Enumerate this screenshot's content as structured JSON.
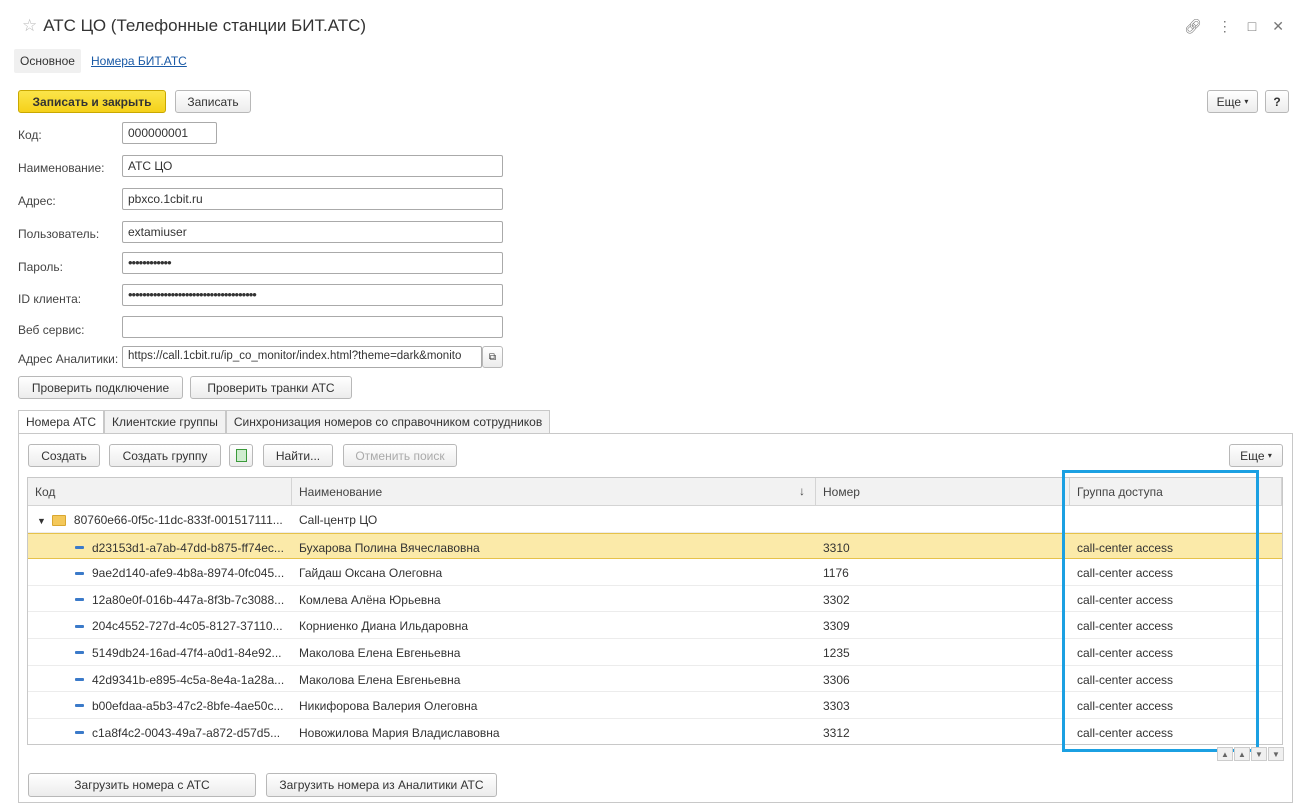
{
  "window": {
    "title": "АТС ЦО (Телефонные станции БИТ.АТС)"
  },
  "nav": {
    "main": "Основное",
    "link": "Номера БИТ.АТС"
  },
  "toolbar": {
    "save_close": "Записать и закрыть",
    "save": "Записать",
    "more": "Еще",
    "help": "?"
  },
  "form": {
    "code": {
      "label": "Код:",
      "value": "000000001"
    },
    "name": {
      "label": "Наименование:",
      "value": "АТС ЦО"
    },
    "address": {
      "label": "Адрес:",
      "value": "pbxco.1cbit.ru"
    },
    "user": {
      "label": "Пользователь:",
      "value": "extamiuser"
    },
    "password": {
      "label": "Пароль:",
      "value": "••••••••••••"
    },
    "client_id": {
      "label": "ID клиента:",
      "value": "••••••••••••••••••••••••••••••••••••"
    },
    "web_service": {
      "label": "Веб сервис:",
      "value": ""
    },
    "analytics": {
      "label": "Адрес Аналитики:",
      "value": "https://call.1cbit.ru/ip_co_monitor/index.html?theme=dark&monito"
    }
  },
  "actions": {
    "check_connection": "Проверить подключение",
    "check_trunks": "Проверить транки АТС"
  },
  "tabs": [
    "Номера АТС",
    "Клиентские группы",
    "Синхронизация номеров со справочником сотрудников"
  ],
  "table_toolbar": {
    "create": "Создать",
    "create_group": "Создать группу",
    "find": "Найти...",
    "cancel_search": "Отменить поиск",
    "more": "Еще"
  },
  "table": {
    "headers": [
      "Код",
      "Наименование",
      "Номер",
      "Группа доступа"
    ],
    "group": {
      "code": "80760e66-0f5c-11dc-833f-001517111...",
      "name": "Call-центр ЦО"
    },
    "rows": [
      {
        "code": "d23153d1-a7ab-47dd-b875-ff74ec...",
        "name": "Бухарова Полина Вячеславовна",
        "number": "3310",
        "group": "call-center access"
      },
      {
        "code": "9ae2d140-afe9-4b8a-8974-0fc045...",
        "name": "Гайдаш Оксана Олеговна",
        "number": "1176",
        "group": "call-center access"
      },
      {
        "code": "12a80e0f-016b-447a-8f3b-7c3088...",
        "name": "Комлева Алёна Юрьевна",
        "number": "3302",
        "group": "call-center access"
      },
      {
        "code": "204c4552-727d-4c05-8127-37110...",
        "name": "Корниенко Диана Ильдаровна",
        "number": "3309",
        "group": "call-center access"
      },
      {
        "code": "5149db24-16ad-47f4-a0d1-84e92...",
        "name": "Маколова Елена Евгеньевна",
        "number": "1235",
        "group": "call-center access"
      },
      {
        "code": "42d9341b-e895-4c5a-8e4a-1a28a...",
        "name": "Маколова Елена Евгеньевна",
        "number": "3306",
        "group": "call-center access"
      },
      {
        "code": "b00efdaa-a5b3-47c2-8bfe-4ae50c...",
        "name": "Никифорова Валерия Олеговна",
        "number": "3303",
        "group": "call-center access"
      },
      {
        "code": "c1a8f4c2-0043-49a7-a872-d57d5...",
        "name": "Новожилова Мария Владиславовна",
        "number": "3312",
        "group": "call-center access"
      }
    ]
  },
  "bottom": {
    "load_pbx": "Загрузить номера с АТС",
    "load_analytics": "Загрузить номера из Аналитики АТС"
  }
}
